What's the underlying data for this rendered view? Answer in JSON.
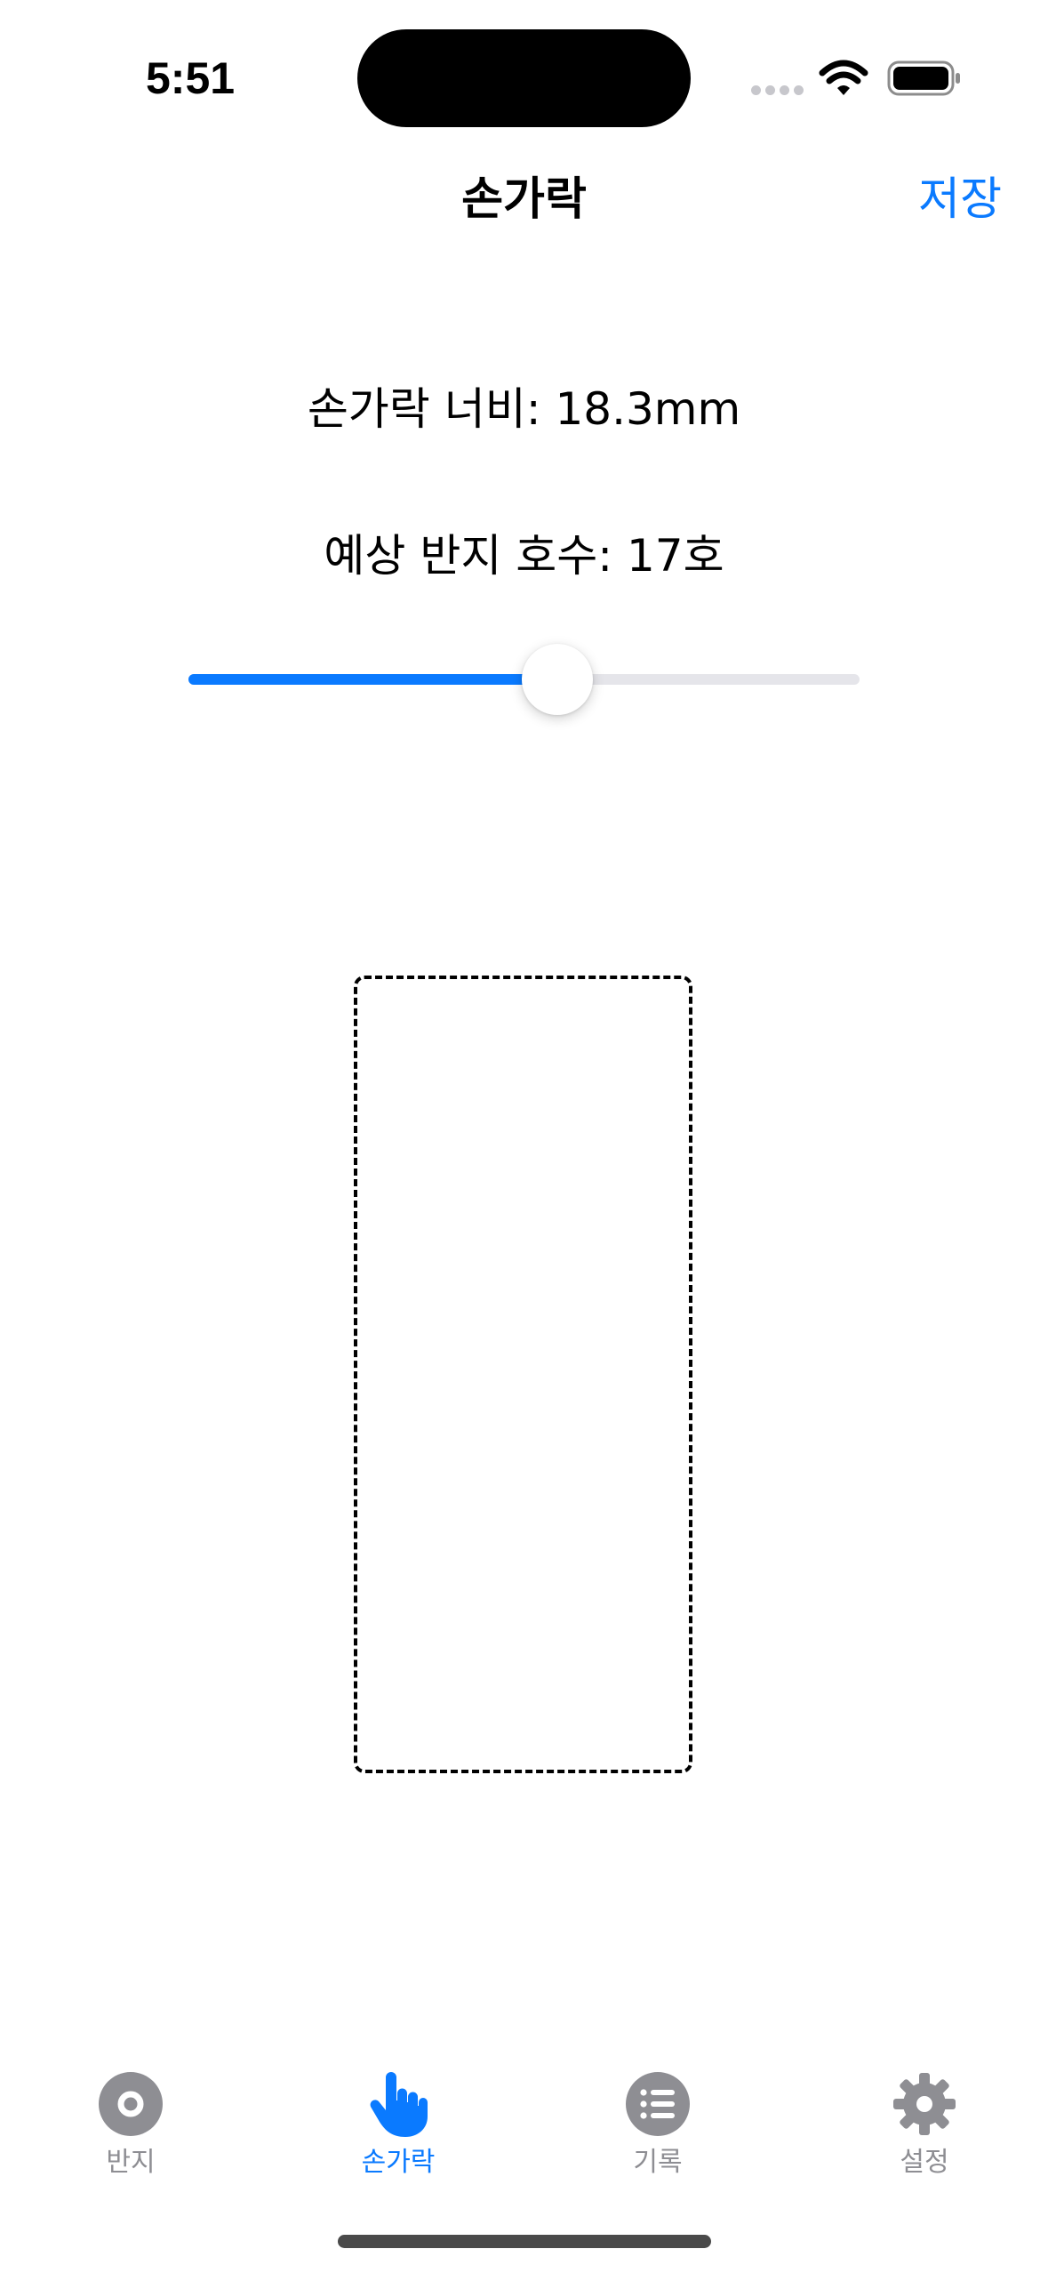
{
  "status_bar": {
    "time": "5:51",
    "icons": [
      "cellular-signal-icon",
      "wifi-icon",
      "battery-icon"
    ]
  },
  "nav": {
    "title": "손가락",
    "save_label": "저장"
  },
  "measurement": {
    "width_label": "손가락 너비: 18.3mm",
    "size_label": "예상 반지 호수: 17호"
  },
  "slider": {
    "fraction": 0.55
  },
  "tabs": [
    {
      "label": "반지",
      "icon": "ring-icon",
      "active": false
    },
    {
      "label": "손가락",
      "icon": "hand-point-icon",
      "active": true
    },
    {
      "label": "기록",
      "icon": "list-icon",
      "active": false
    },
    {
      "label": "설정",
      "icon": "gear-icon",
      "active": false
    }
  ],
  "colors": {
    "accent": "#0a7aff",
    "inactive": "#8e8e93",
    "track": "#e5e5ea"
  }
}
